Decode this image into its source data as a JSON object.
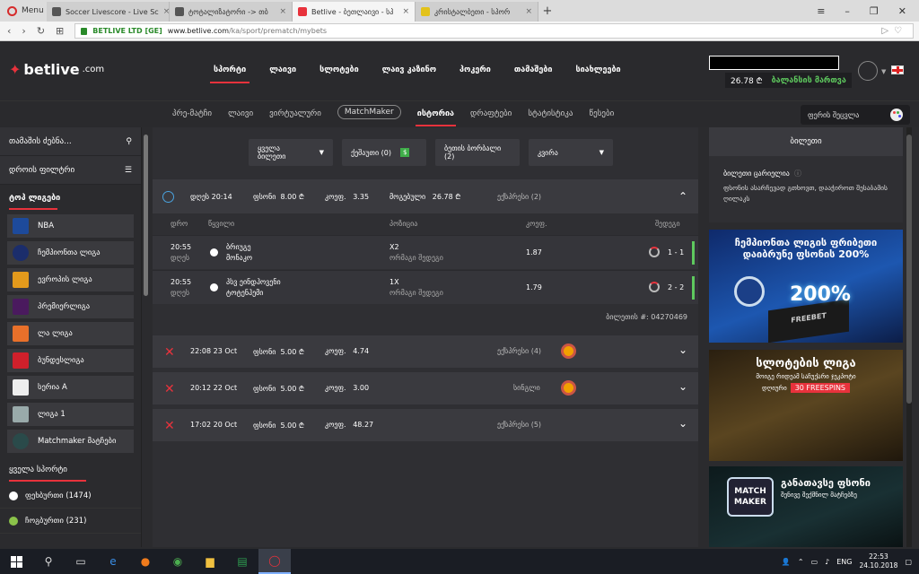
{
  "browser": {
    "menu_label": "Menu",
    "tabs": [
      {
        "label": "Soccer Livescore - Live Sc",
        "active": false
      },
      {
        "label": "ტოტალიზატორი -> თბ",
        "active": false
      },
      {
        "label": "Betlive - ბეთლაივი - სპ",
        "active": true
      },
      {
        "label": "კრისტალბეთი - სპორ",
        "active": false
      }
    ],
    "cert": "BETLIVE LTD [GE]",
    "url_host": "www.betlive.com",
    "url_path": "/ka/sport/prematch/mybets"
  },
  "header": {
    "logo": "betlive",
    "logo_suffix": ".com",
    "nav": [
      "სპორტი",
      "ლაივი",
      "სლოტები",
      "ლაივ კაზინო",
      "პოკერი",
      "თამაშები",
      "სიახლეები"
    ],
    "balance": "26.78 ₾",
    "balance_link": "ბალანსის მართვა"
  },
  "subnav": {
    "items": [
      "პრე-მატჩი",
      "ლაივი",
      "ვირტუალური",
      "MatchMaker",
      "ისტორია",
      "დრაფტები",
      "სტატისტიკა",
      "წესები"
    ],
    "theme_label": "ფერის შეცვლა"
  },
  "left": {
    "search": "თამაშის ძებნა...",
    "time_filter": "დროის ფილტრი",
    "top_leagues": "ტოპ ლიგები",
    "leagues": [
      "NBA",
      "ჩემპიონთა ლიგა",
      "ევროპის ლიგა",
      "პრემიერლიგა",
      "ლა ლიგა",
      "ბუნდესლიგა",
      "სერია A",
      "ლიგა 1",
      "Matchmaker მატჩები"
    ],
    "all_sports": "ყველა სპორტი",
    "sports": [
      {
        "label": "ფეხბურთი (1474)"
      },
      {
        "label": "ჩოგბურთი (231)"
      }
    ]
  },
  "filters": {
    "all_tickets": "ყველა ბილეთი",
    "stake_count": "ქეშაუთი (0)",
    "cashout_count": "ბეთის ბორბალი (2)",
    "period": "კვირა"
  },
  "open_ticket": {
    "date": "დღეს 20:14",
    "stake_label": "ფსონი",
    "stake": "8.00 ₾",
    "coef_label": "კოეფ.",
    "coef": "3.35",
    "win_label": "მოგებული",
    "win": "26.78 ₾",
    "type": "ექსპრესი (2)",
    "columns": [
      "დრო",
      "წყვილი",
      "პოზიცია",
      "კოეფ.",
      "შედეგი"
    ],
    "matches": [
      {
        "time": "20:55",
        "day": "დღეს",
        "team1": "ბრიუგე",
        "team2": "მონაკო",
        "pick": "X2",
        "market": "ორმაგი შედეგი",
        "coef": "1.87",
        "result": "1 - 1"
      },
      {
        "time": "20:55",
        "day": "დღეს",
        "team1": "პსვ ეინდჰოვენი",
        "team2": "ტოტენჰემი",
        "pick": "1X",
        "market": "ორმაგი შედეგი",
        "coef": "1.79",
        "result": "2 - 2"
      }
    ],
    "ticket_id": "ბილეთის #: 04270469"
  },
  "lost_tickets": [
    {
      "date": "22:08 23 Oct",
      "stake_label": "ფსონი",
      "stake": "5.00 ₾",
      "coef_label": "კოეფ.",
      "coef": "4.74",
      "type": "ექსპრესი (4)",
      "wheel": true
    },
    {
      "date": "20:12 22 Oct",
      "stake_label": "ფსონი",
      "stake": "5.00 ₾",
      "coef_label": "კოეფ.",
      "coef": "3.00",
      "type": "სინგლი",
      "wheel": true
    },
    {
      "date": "17:02 20 Oct",
      "stake_label": "ფსონი",
      "stake": "5.00 ₾",
      "coef_label": "კოეფ.",
      "coef": "48.27",
      "type": "ექსპრესი (5)",
      "wheel": false
    }
  ],
  "right": {
    "title": "ბილეთი",
    "ticket_type": "ბილეთი ცარიელია",
    "hint": "ფსონის ასარჩევად გთხოვთ, დააჭიროთ შესაბამის ღილაკს",
    "banner1_line1": "ჩემპიონთა ლიგის ფრიბეთი",
    "banner1_line2": "დაიბრუნე ფსონის 200%",
    "banner1_big": "200%",
    "banner1_box": "FREEBET",
    "banner2_line1": "სლოტების ლიგა",
    "banner2_sub": "მოიგე რიდეამ საჩუქარი ჯეკპოტი",
    "banner2_sub2": "დღიური",
    "banner2_pill": "30 FREESPINS",
    "banner3_logo": "MATCH MAKER",
    "banner3_line1": "განათავსე ფსონი",
    "banner3_line2": "შენივე შექმნილ მატჩებზე"
  },
  "taskbar": {
    "lang": "ENG",
    "time": "22:53",
    "date": "24.10.2018"
  }
}
